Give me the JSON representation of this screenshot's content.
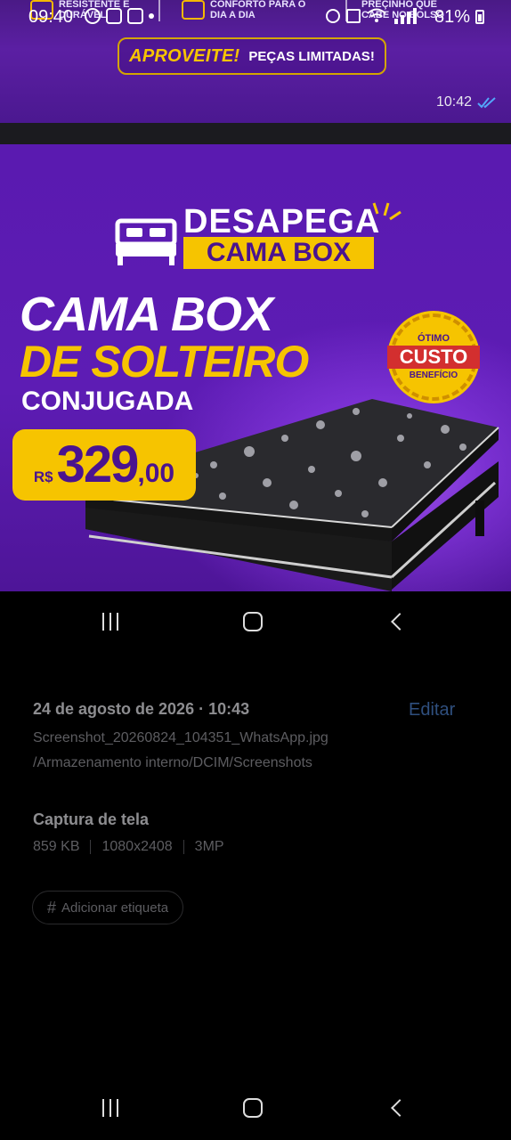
{
  "status_bar": {
    "time": "09:40",
    "battery": "81%"
  },
  "top_ad": {
    "features": [
      "RESISTENTE E DURÁVEL",
      "CONFORTO PARA O DIA A DIA",
      "PREÇINHO QUE CABE NO BOLSO"
    ],
    "banner_highlight": "APROVEITE!",
    "banner_text": "PEÇAS LIMITADAS!",
    "message_time": "10:42"
  },
  "product_image": {
    "brand_top": "DESAPEGA",
    "brand_bottom": "CAMA BOX",
    "headline_1": "CAMA BOX",
    "headline_2": "DE SOLTEIRO",
    "headline_3": "CONJUGADA",
    "price_currency": "R$",
    "price_main": "329",
    "price_cents": ",00",
    "seal_top": "ÓTIMO",
    "seal_middle": "CUSTO",
    "seal_bottom": "BENEFÍCIO"
  },
  "details": {
    "date": "24 de agosto de 2026 · 10:43",
    "edit_label": "Editar",
    "file_name": "Screenshot_20260824_104351_WhatsApp.jpg",
    "file_path": "/Armazenamento interno/DCIM/Screenshots",
    "type_label": "Captura de tela",
    "size": "859 KB",
    "resolution": "1080x2408",
    "megapixels": "3MP",
    "add_tag_label": "Adicionar etiqueta"
  },
  "colors": {
    "purple": "#5a1ab0",
    "yellow": "#f6c400",
    "edit_link": "#2f4f7e"
  }
}
